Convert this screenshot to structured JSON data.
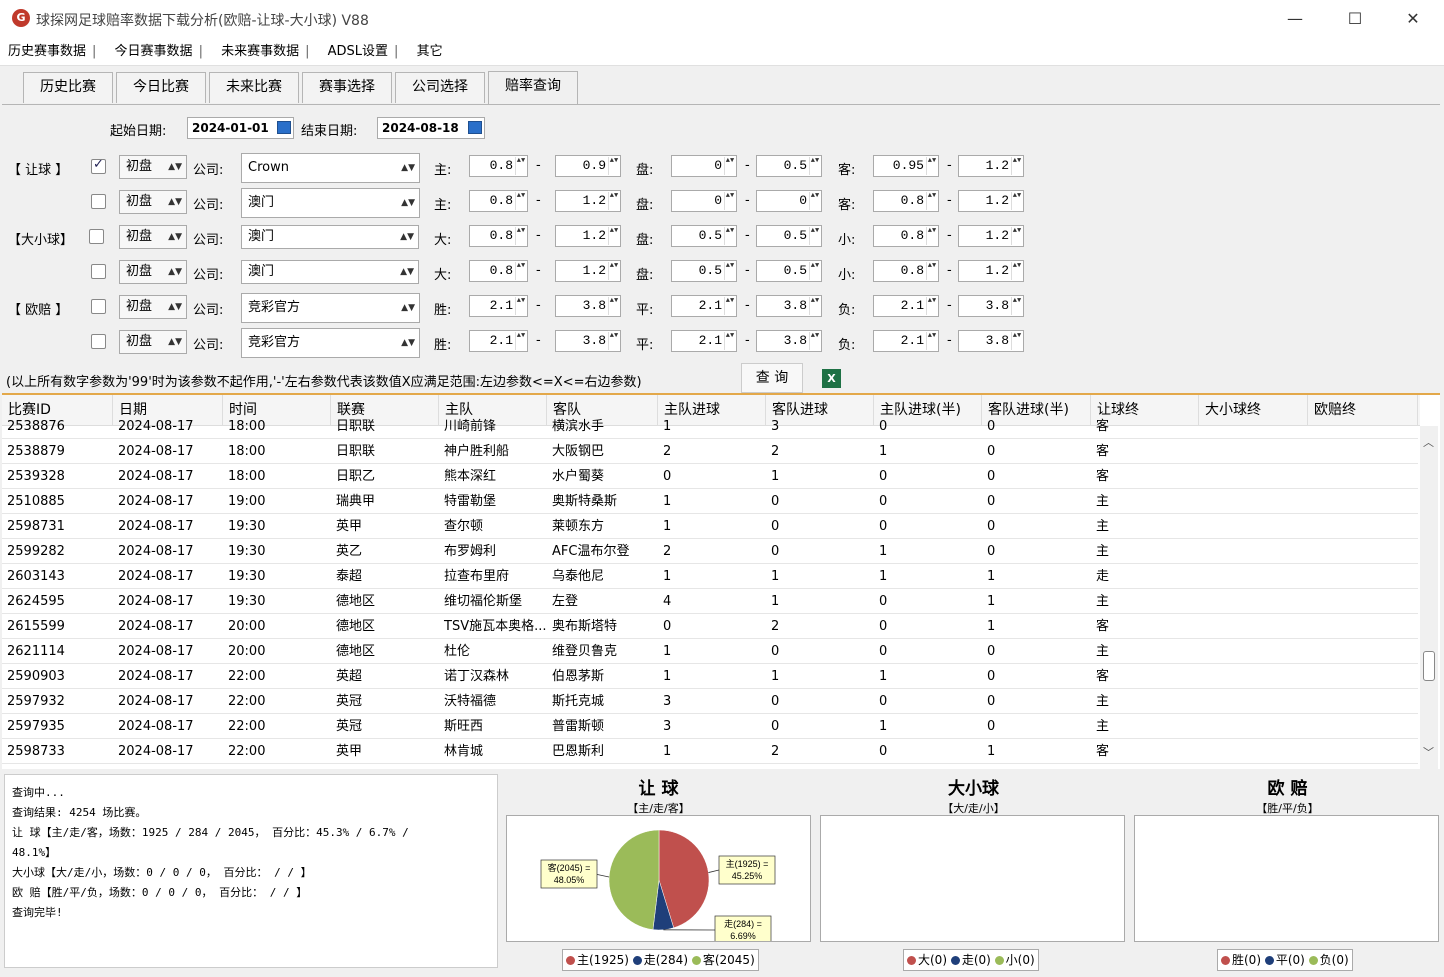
{
  "window": {
    "title": "球探网足球赔率数据下载分析(欧赔-让球-大小球) V88",
    "min": "—",
    "max": "☐",
    "close": "✕"
  },
  "menu": [
    "历史赛事数据",
    "今日赛事数据",
    "未来赛事数据",
    "ADSL设置",
    "其它"
  ],
  "tabs": [
    "历史比赛",
    "今日比赛",
    "未来比赛",
    "赛事选择",
    "公司选择",
    "赔率查询"
  ],
  "dates": {
    "start_label": "起始日期:",
    "start": "2024-01-01",
    "end_label": "结束日期:",
    "end": "2024-08-18"
  },
  "filter_rows": [
    {
      "group": "【 让球 】",
      "checked": true,
      "type": "初盘",
      "company": "Crown",
      "a_label": "主:",
      "a1": "0.8",
      "a2": "0.9",
      "b_label": "盘:",
      "b1": "0",
      "b2": "0.5",
      "c_label": "客:",
      "c1": "0.95",
      "c2": "1.2"
    },
    {
      "group": "",
      "checked": false,
      "type": "初盘",
      "company": "澳门",
      "a_label": "主:",
      "a1": "0.8",
      "a2": "1.2",
      "b_label": "盘:",
      "b1": "0",
      "b2": "0",
      "c_label": "客:",
      "c1": "0.8",
      "c2": "1.2"
    },
    {
      "group": "【大小球】",
      "checked": false,
      "type": "初盘",
      "company": "澳门",
      "a_label": "大:",
      "a1": "0.8",
      "a2": "1.2",
      "b_label": "盘:",
      "b1": "0.5",
      "b2": "0.5",
      "c_label": "小:",
      "c1": "0.8",
      "c2": "1.2"
    },
    {
      "group": "",
      "checked": false,
      "type": "初盘",
      "company": "澳门",
      "a_label": "大:",
      "a1": "0.8",
      "a2": "1.2",
      "b_label": "盘:",
      "b1": "0.5",
      "b2": "0.5",
      "c_label": "小:",
      "c1": "0.8",
      "c2": "1.2"
    },
    {
      "group": "【 欧赔 】",
      "checked": false,
      "type": "初盘",
      "company": "竞彩官方",
      "a_label": "胜:",
      "a1": "2.1",
      "a2": "3.8",
      "b_label": "平:",
      "b1": "2.1",
      "b2": "3.8",
      "c_label": "负:",
      "c1": "2.1",
      "c2": "3.8"
    },
    {
      "group": "",
      "checked": false,
      "type": "初盘",
      "company": "竞彩官方",
      "a_label": "胜:",
      "a1": "2.1",
      "a2": "3.8",
      "b_label": "平:",
      "b1": "2.1",
      "b2": "3.8",
      "c_label": "负:",
      "c1": "2.1",
      "c2": "3.8"
    }
  ],
  "company_label": "公司:",
  "note": "(以上所有数字参数为'99'时为该参数不起作用,'-'左右参数代表该数值X应满足范围:左边参数<=X<=右边参数)",
  "query_button": "查 询",
  "excel_icon": "X",
  "table": {
    "headers": [
      "比赛ID",
      "日期",
      "时间",
      "联赛",
      "主队",
      "客队",
      "主队进球",
      "客队进球",
      "主队进球(半)",
      "客队进球(半)",
      "让球终",
      "大小球终",
      "欧赔终"
    ],
    "rows": [
      [
        "2538876",
        "2024-08-17",
        "18:00",
        "日职联",
        "川崎前锋",
        "横滨水手",
        "1",
        "3",
        "0",
        "0",
        "客"
      ],
      [
        "2538879",
        "2024-08-17",
        "18:00",
        "日职联",
        "神户胜利船",
        "大阪钢巴",
        "2",
        "2",
        "1",
        "0",
        "客"
      ],
      [
        "2539328",
        "2024-08-17",
        "18:00",
        "日职乙",
        "熊本深红",
        "水户蜀葵",
        "0",
        "1",
        "0",
        "0",
        "客"
      ],
      [
        "2510885",
        "2024-08-17",
        "19:00",
        "瑞典甲",
        "特雷勒堡",
        "奥斯特桑斯",
        "1",
        "0",
        "0",
        "0",
        "主"
      ],
      [
        "2598731",
        "2024-08-17",
        "19:30",
        "英甲",
        "查尔顿",
        "莱顿东方",
        "1",
        "0",
        "0",
        "0",
        "主"
      ],
      [
        "2599282",
        "2024-08-17",
        "19:30",
        "英乙",
        "布罗姆利",
        "AFC温布尔登",
        "2",
        "0",
        "1",
        "0",
        "主"
      ],
      [
        "2603143",
        "2024-08-17",
        "19:30",
        "泰超",
        "拉查布里府",
        "乌泰他尼",
        "1",
        "1",
        "1",
        "1",
        "走"
      ],
      [
        "2624595",
        "2024-08-17",
        "19:30",
        "德地区",
        "维切福伦斯堡",
        "左登",
        "4",
        "1",
        "0",
        "1",
        "主"
      ],
      [
        "2615599",
        "2024-08-17",
        "20:00",
        "德地区",
        "TSV施瓦本奥格...",
        "奥布斯塔特",
        "0",
        "2",
        "0",
        "1",
        "客"
      ],
      [
        "2621114",
        "2024-08-17",
        "20:00",
        "德地区",
        "杜伦",
        "维登贝鲁克",
        "1",
        "0",
        "0",
        "0",
        "主"
      ],
      [
        "2590903",
        "2024-08-17",
        "22:00",
        "英超",
        "诺丁汉森林",
        "伯恩茅斯",
        "1",
        "1",
        "1",
        "0",
        "客"
      ],
      [
        "2597932",
        "2024-08-17",
        "22:00",
        "英冠",
        "沃特福德",
        "斯托克城",
        "3",
        "0",
        "0",
        "0",
        "主"
      ],
      [
        "2597935",
        "2024-08-17",
        "22:00",
        "英冠",
        "斯旺西",
        "普雷斯顿",
        "3",
        "0",
        "1",
        "0",
        "主"
      ],
      [
        "2598733",
        "2024-08-17",
        "22:00",
        "英甲",
        "林肯城",
        "巴恩斯利",
        "1",
        "2",
        "0",
        "1",
        "客"
      ]
    ]
  },
  "log": [
    "查询中...",
    "查询结果: 4254 场比赛。",
    "让 球【主/走/客，场数：1925 / 284 / 2045， 百分比：45.3% / 6.7% /",
    "48.1%】",
    "大小球【大/走/小，场数：0 / 0 / 0， 百分比： /  / 】",
    "欧 赔【胜/平/负，场数：0 / 0 / 0， 百分比： /  / 】",
    "查询完毕!"
  ],
  "charts": [
    {
      "title": "让 球",
      "subtitle": "【主/走/客】",
      "legend": [
        "主(1925)",
        "走(284)",
        "客(2045)"
      ]
    },
    {
      "title": "大小球",
      "subtitle": "【大/走/小】",
      "legend": [
        "大(0)",
        "走(0)",
        "小(0)"
      ]
    },
    {
      "title": "欧 赔",
      "subtitle": "【胜/平/负】",
      "legend": [
        "胜(0)",
        "平(0)",
        "负(0)"
      ]
    }
  ],
  "chart_data": {
    "type": "pie",
    "title": "让 球",
    "subtitle": "【主/走/客】",
    "categories": [
      "主",
      "走",
      "客"
    ],
    "values": [
      1925,
      284,
      2045
    ],
    "percent": [
      45.25,
      6.69,
      48.05
    ],
    "labels": [
      "主(1925) =\n45.25%",
      "走(284) =\n6.69%",
      "客(2045) =\n48.05%"
    ],
    "colors": [
      "#c0504d",
      "#1f3f7a",
      "#9bbb59"
    ]
  }
}
